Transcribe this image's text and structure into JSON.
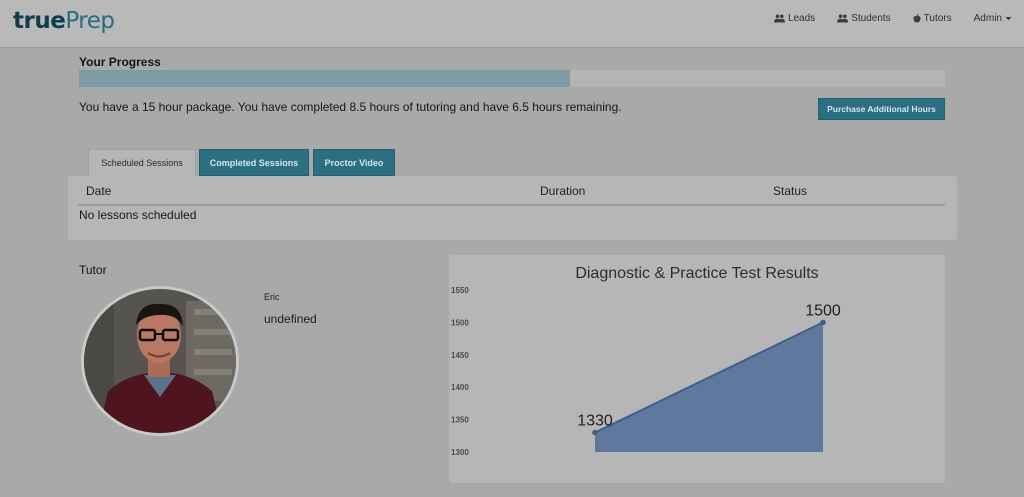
{
  "brand": {
    "part1": "true",
    "part2": "Prep"
  },
  "nav": {
    "leads": "Leads",
    "students": "Students",
    "tutors": "Tutors",
    "admin": "Admin"
  },
  "progress": {
    "title": "Your Progress",
    "fraction": 0.567,
    "message": "You have a 15 hour package. You have completed 8.5 hours of tutoring and have 6.5 hours remaining.",
    "purchase_button": "Purchase Additional Hours"
  },
  "tabs": [
    {
      "label": "Scheduled Sessions",
      "active": true
    },
    {
      "label": "Completed Sessions",
      "active": false
    },
    {
      "label": "Proctor Video",
      "active": false
    }
  ],
  "sessions_table": {
    "headers": [
      "Date",
      "Duration",
      "Status"
    ],
    "empty_message": "No lessons scheduled"
  },
  "tutor": {
    "label": "Tutor",
    "name": "Eric",
    "detail": "undefined"
  },
  "chart_data": {
    "type": "area",
    "title": "Diagnostic & Practice Test Results",
    "x": [
      1,
      2
    ],
    "values": [
      1330,
      1500
    ],
    "data_labels": [
      "1330",
      "1500"
    ],
    "ylim": [
      1300,
      1550
    ],
    "yticks": [
      "1550",
      "1500",
      "1450",
      "1400",
      "1350",
      "1300"
    ],
    "grid": false,
    "color": "#5f789e"
  }
}
